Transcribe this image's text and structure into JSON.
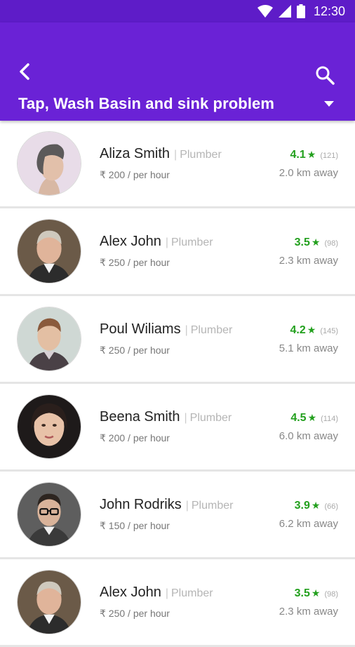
{
  "status_bar": {
    "time": "12:30"
  },
  "app_bar": {
    "title": "Tap, Wash Basin and sink problem"
  },
  "providers": [
    {
      "name": "Aliza Smith",
      "role": "Plumber",
      "price": "₹ 200 / per hour",
      "rating": "4.1",
      "reviews": "(121)",
      "distance": "2.0 km away",
      "avatar": "woman-profile-avatar"
    },
    {
      "name": "Alex John",
      "role": "Plumber",
      "price": "₹ 250 / per hour",
      "rating": "3.5",
      "reviews": "(98)",
      "distance": "2.3 km away",
      "avatar": "man-older-avatar"
    },
    {
      "name": "Poul Wiliams",
      "role": "Plumber",
      "price": "₹ 250 / per hour",
      "rating": "4.2",
      "reviews": "(145)",
      "distance": "5.1 km away",
      "avatar": "man-young-avatar"
    },
    {
      "name": "Beena Smith",
      "role": "Plumber",
      "price": "₹ 200 / per hour",
      "rating": "4.5",
      "reviews": "(114)",
      "distance": "6.0 km away",
      "avatar": "woman-dark-hair-avatar"
    },
    {
      "name": "John Rodriks",
      "role": "Plumber",
      "price": "₹ 150 / per hour",
      "rating": "3.9",
      "reviews": "(66)",
      "distance": "6.2 km away",
      "avatar": "man-glasses-avatar"
    },
    {
      "name": "Alex John",
      "role": "Plumber",
      "price": "₹ 250 / per hour",
      "rating": "3.5",
      "reviews": "(98)",
      "distance": "2.3 km away",
      "avatar": "man-older-avatar"
    }
  ],
  "colors": {
    "primary": "#6a22d6",
    "status_bar": "#5e1cc8",
    "rating_green": "#23a01e"
  }
}
